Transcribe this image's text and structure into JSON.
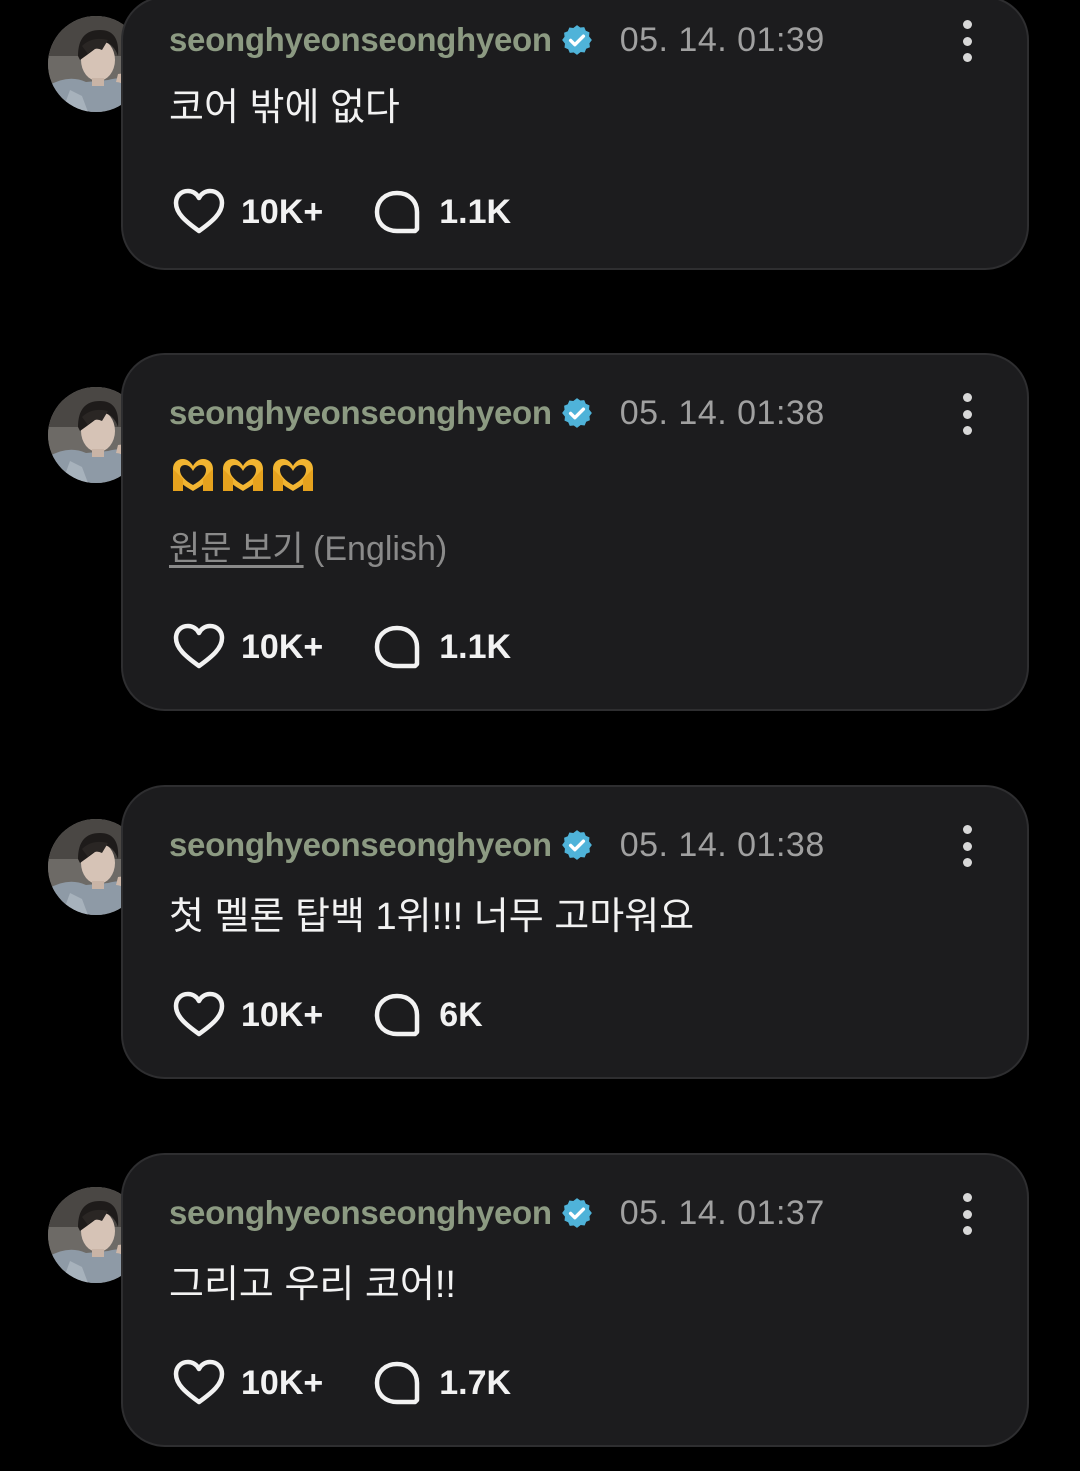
{
  "posts": [
    {
      "username": "seonghyeonseonghyeon",
      "timestamp": "05. 14. 01:39",
      "content": "코어 밖에 없다",
      "likes": "10K+",
      "comments": "1.1K"
    },
    {
      "username": "seonghyeonseonghyeon",
      "timestamp": "05. 14. 01:38",
      "content": "🫶🫶🫶",
      "translate_link": "원문 보기",
      "translate_lang": "(English)",
      "likes": "10K+",
      "comments": "1.1K"
    },
    {
      "username": "seonghyeonseonghyeon",
      "timestamp": "05. 14. 01:38",
      "content": "첫 멜론 탑백 1위!!! 너무 고마워요",
      "likes": "10K+",
      "comments": "6K"
    },
    {
      "username": "seonghyeonseonghyeon",
      "timestamp": "05. 14. 01:37",
      "content": "그리고 우리 코어!!",
      "likes": "10K+",
      "comments": "1.7K"
    }
  ],
  "colors": {
    "background": "#000000",
    "card": "#1c1c1e",
    "username": "#8c9a82",
    "verified": "#4fb3d9",
    "text": "#f2f2f2",
    "muted": "#a0a0a0",
    "heart_emoji": "#f2b531"
  },
  "icons": {
    "verified": "verified-badge-icon",
    "more": "more-vertical-icon",
    "like": "heart-outline-icon",
    "comment": "comment-bubble-icon"
  }
}
